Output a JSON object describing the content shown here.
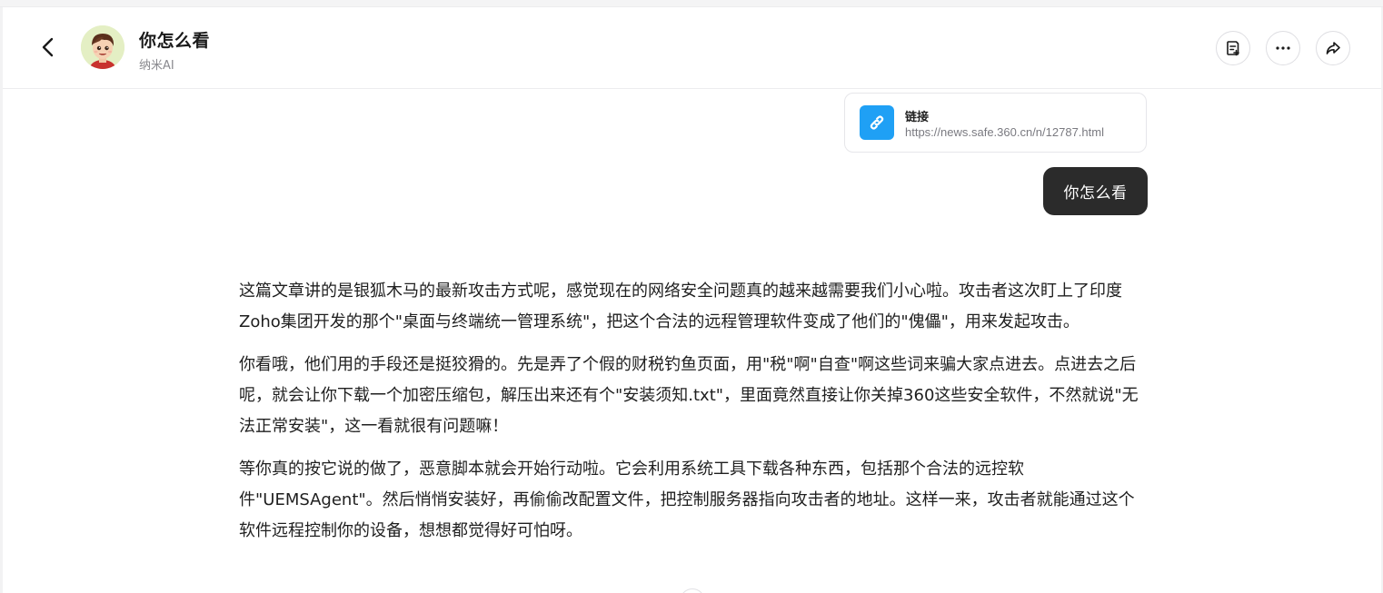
{
  "header": {
    "title": "你怎么看",
    "subtitle": "纳米AI",
    "back_icon": "chevron-left-icon",
    "actions": [
      {
        "name": "notes-button",
        "icon": "notes-icon"
      },
      {
        "name": "more-button",
        "icon": "ellipsis-icon"
      },
      {
        "name": "share-button",
        "icon": "share-icon"
      }
    ]
  },
  "conversation": {
    "link_card": {
      "title": "链接",
      "url": "https://news.safe.360.cn/n/12787.html",
      "icon": "link-icon",
      "icon_color": "#1fa0f5"
    },
    "user_message": "你怎么看",
    "reply_paragraphs": [
      "这篇文章讲的是银狐木马的最新攻击方式呢，感觉现在的网络安全问题真的越来越需要我们小心啦。攻击者这次盯上了印度Zoho集团开发的那个\"桌面与终端统一管理系统\"，把这个合法的远程管理软件变成了他们的\"傀儡\"，用来发起攻击。",
      "你看哦，他们用的手段还是挺狡猾的。先是弄了个假的财税钓鱼页面，用\"税\"啊\"自查\"啊这些词来骗大家点进去。点进去之后呢，就会让你下载一个加密压缩包，解压出来还有个\"安装须知.txt\"，里面竟然直接让你关掉360这些安全软件，不然就说\"无法正常安装\"，这一看就很有问题嘛！",
      "等你真的按它说的做了，恶意脚本就会开始行动啦。它会利用系统工具下载各种东西，包括那个合法的远控软件\"UEMSAgent\"。然后悄悄安装好，再偷偷改配置文件，把控制服务器指向攻击者的地址。这样一来，攻击者就能通过这个软件远程控制你的设备，想想都觉得好可怕呀。"
    ]
  },
  "colors": {
    "user_bubble_bg": "#2b2b2b",
    "link_icon_bg": "#1fa0f5"
  }
}
